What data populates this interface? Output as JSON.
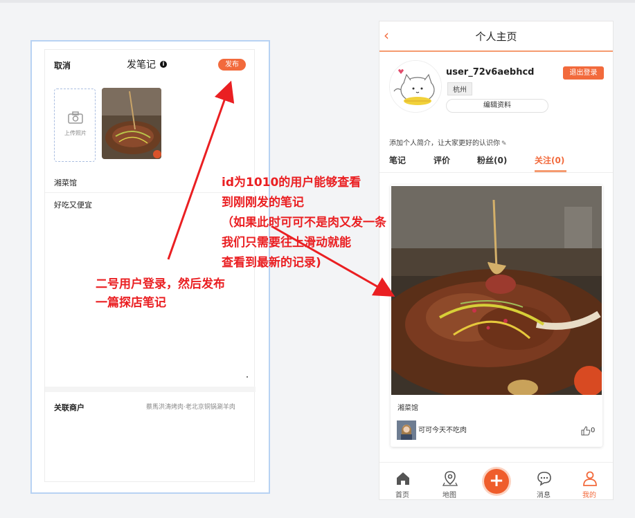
{
  "left_phone": {
    "cancel_label": "取消",
    "title": "发笔记",
    "info_icon": "i",
    "publish_label": "发布",
    "upload_label": "上传照片",
    "shop_name": "湘菜馆",
    "content": "好吃又便宜",
    "merchant_label": "关联商户",
    "merchant_value": "蔡馬洪涛烤肉·老北京铜锅涮羊肉"
  },
  "right_phone": {
    "back_icon": "‹",
    "title": "个人主页",
    "username": "user_72v6aebhcd",
    "city": "杭州",
    "logout_label": "退出登录",
    "edit_label": "编辑资料",
    "bio": "添加个人简介，让大家更好的认识你",
    "tabs": [
      {
        "label": "笔记"
      },
      {
        "label": "评价"
      },
      {
        "label": "粉丝(0)"
      },
      {
        "label": "关注(0)"
      }
    ],
    "card": {
      "shop_name": "湘菜馆",
      "user_name": "可可今天不吃肉",
      "like_count": "0"
    },
    "nav": [
      {
        "label": "首页",
        "icon": "home-icon"
      },
      {
        "label": "地图",
        "icon": "map-pin-icon"
      },
      {
        "label": "消息",
        "icon": "message-icon"
      },
      {
        "label": "我的",
        "icon": "user-icon"
      }
    ],
    "plus_symbol": "+"
  },
  "annotations": {
    "left_line1": "二号用户登录，然后发布",
    "left_line2": "一篇探店笔记",
    "right_line1": "id为1010的用户能够查看",
    "right_line2": "到刚刚发的笔记",
    "right_line3": "（如果此时可可不是肉又发一条",
    "right_line4": "我们只需要往上滑动就能",
    "right_line5": "查看到最新的记录)"
  },
  "colors": {
    "accent": "#f26a3c",
    "annotation_red": "#ea1f22"
  }
}
